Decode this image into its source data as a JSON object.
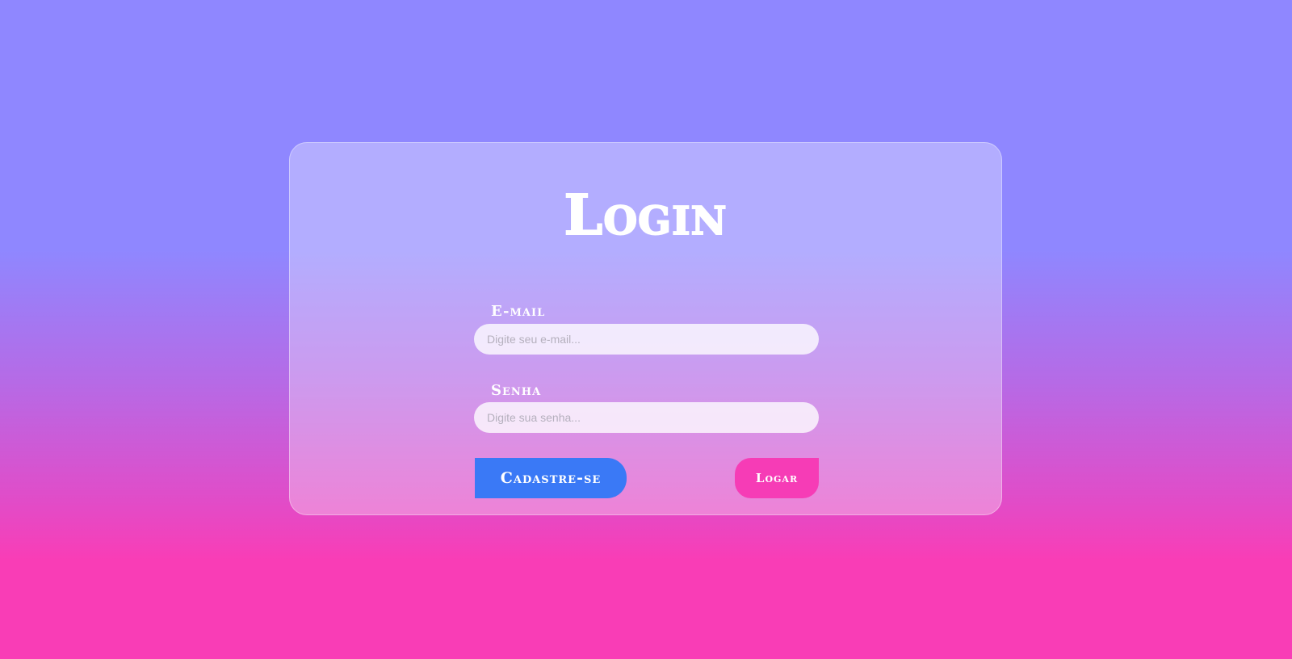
{
  "login": {
    "title": "Login",
    "email_label": "E-mail",
    "email_placeholder": "Digite seu e-mail...",
    "password_label": "Senha",
    "password_placeholder": "Digite sua senha...",
    "register_button": "Cadastre-se",
    "submit_button": "Logar"
  },
  "colors": {
    "background_top": "#8f87ff",
    "background_bottom": "#f93db6",
    "register_button": "#3a79f6",
    "submit_button": "#f63cb6"
  }
}
